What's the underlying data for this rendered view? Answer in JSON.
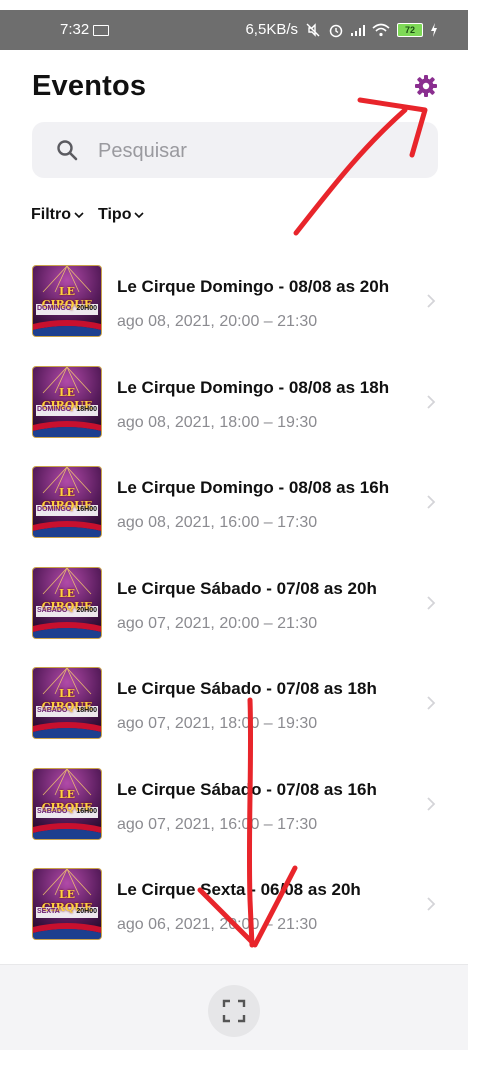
{
  "status_bar": {
    "time": "7:32",
    "network_speed": "6,5KB/s",
    "battery": "72",
    "icons": [
      "screen-cast-icon",
      "mute-icon",
      "alarm-icon",
      "signal-icon",
      "wifi-icon",
      "battery-icon",
      "charging-icon"
    ]
  },
  "header": {
    "title": "Eventos",
    "settings_icon": "gear-icon",
    "accent": "#8a2e8f"
  },
  "search": {
    "placeholder": "Pesquisar",
    "value": ""
  },
  "filters": [
    {
      "label": "Filtro"
    },
    {
      "label": "Tipo"
    }
  ],
  "events": [
    {
      "title": "Le Cirque Domingo - 08/08 as 20h",
      "subtitle": "ago 08, 2021, 20:00 – 21:30",
      "thumb_day": "DOMINGO",
      "thumb_time": "20H00"
    },
    {
      "title": "Le Cirque Domingo - 08/08 as 18h",
      "subtitle": "ago 08, 2021, 18:00 – 19:30",
      "thumb_day": "DOMINGO",
      "thumb_time": "18H00"
    },
    {
      "title": "Le Cirque Domingo - 08/08 as 16h",
      "subtitle": "ago 08, 2021, 16:00 – 17:30",
      "thumb_day": "DOMINGO",
      "thumb_time": "16H00"
    },
    {
      "title": "Le Cirque Sábado - 07/08 as 20h",
      "subtitle": "ago 07, 2021, 20:00 – 21:30",
      "thumb_day": "SÁBADO",
      "thumb_time": "20H00"
    },
    {
      "title": "Le Cirque Sábado - 07/08 as 18h",
      "subtitle": "ago 07, 2021, 18:00 – 19:30",
      "thumb_day": "SÁBADO",
      "thumb_time": "18H00"
    },
    {
      "title": "Le Cirque Sábado - 07/08 as 16h",
      "subtitle": "ago 07, 2021, 16:00 – 17:30",
      "thumb_day": "SÁBADO",
      "thumb_time": "16H00"
    },
    {
      "title": "Le Cirque Sexta - 06/08 as 20h",
      "subtitle": "ago 06, 2021, 20:00 – 21:30",
      "thumb_day": "SEXTA",
      "thumb_time": "20H00"
    }
  ],
  "thumb_logo": "LE CIRQUE",
  "bottom_bar": {
    "fullscreen_icon": "fullscreen-icon"
  },
  "annotation_color": "#e8252b"
}
